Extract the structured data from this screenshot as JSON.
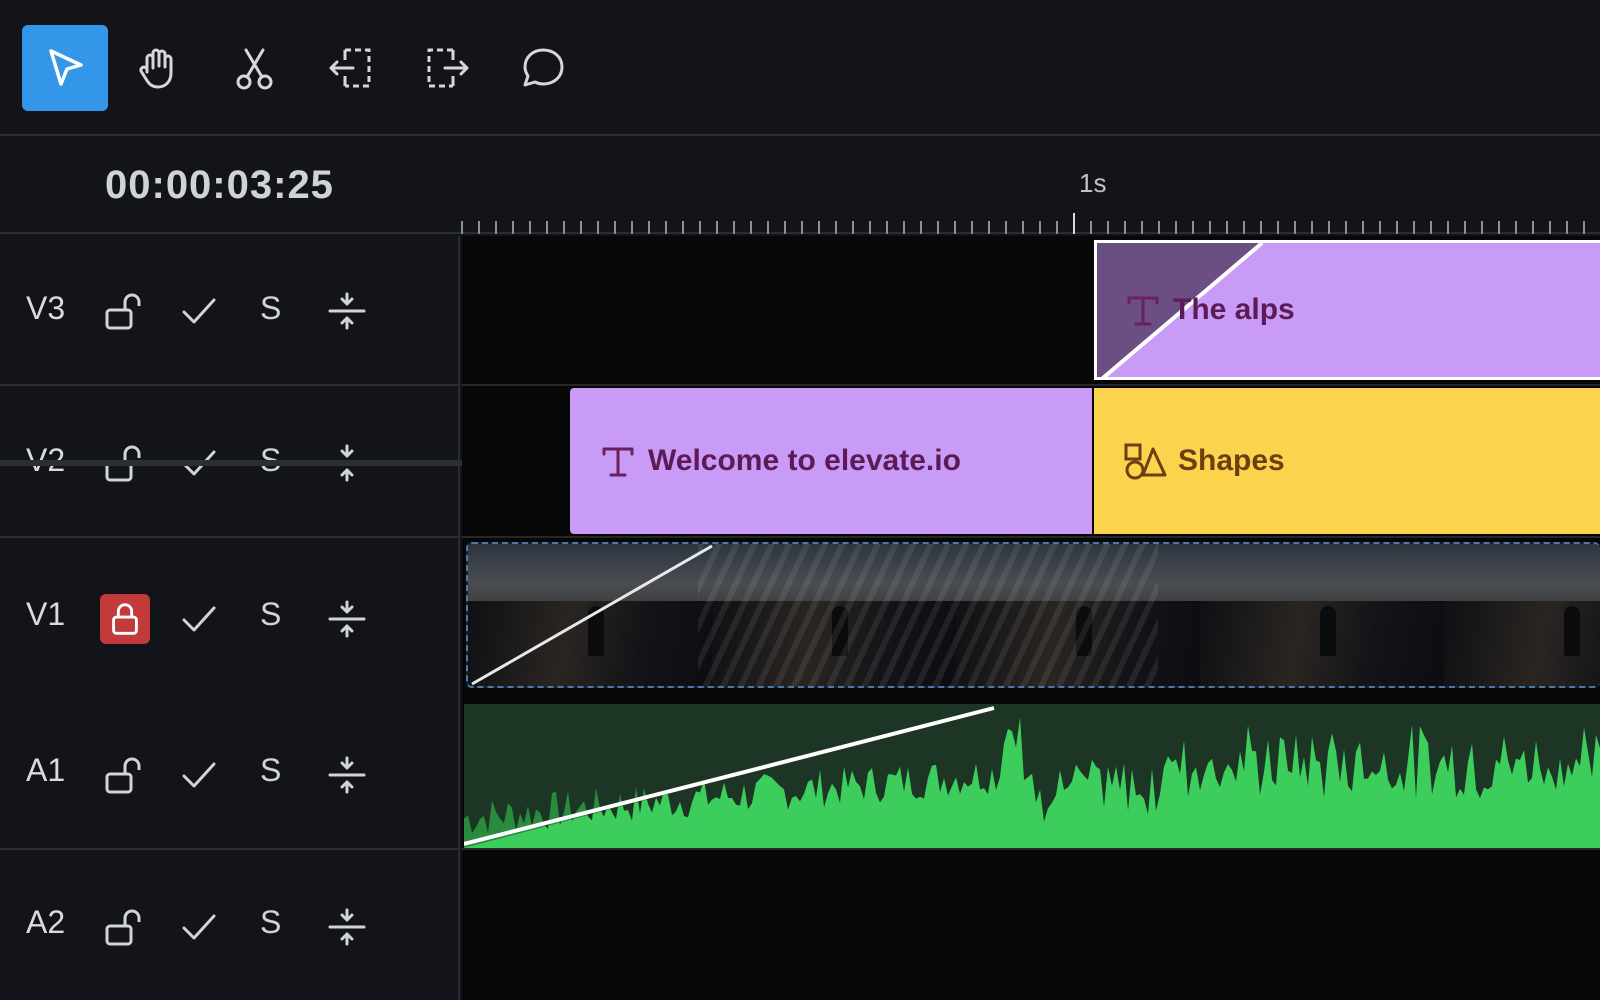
{
  "toolbar": {
    "tools": [
      {
        "name": "select",
        "icon": "pointer-icon",
        "active": true
      },
      {
        "name": "hand",
        "icon": "hand-icon",
        "active": false
      },
      {
        "name": "cut",
        "icon": "scissors-icon",
        "active": false
      },
      {
        "name": "trim-start",
        "icon": "trim-left-icon",
        "active": false
      },
      {
        "name": "trim-end",
        "icon": "trim-right-icon",
        "active": false
      },
      {
        "name": "comment",
        "icon": "comment-icon",
        "active": false
      }
    ]
  },
  "ruler": {
    "timecode": "00:00:03:25",
    "marker_label": "1s"
  },
  "tracks": [
    {
      "name": "V3",
      "locked": false,
      "enabled": true,
      "solo_label": "S"
    },
    {
      "name": "V2",
      "locked": false,
      "enabled": true,
      "solo_label": "S"
    },
    {
      "name": "V1",
      "locked": true,
      "enabled": true,
      "solo_label": "S"
    },
    {
      "name": "A1",
      "locked": false,
      "enabled": true,
      "solo_label": "S"
    },
    {
      "name": "A2",
      "locked": false,
      "enabled": true,
      "solo_label": "S"
    }
  ],
  "clips": {
    "v3_text": {
      "label": "The alps",
      "icon": "text-icon"
    },
    "v2_text": {
      "label": "Welcome to elevate.io",
      "icon": "text-icon"
    },
    "v2_shapes": {
      "label": "Shapes",
      "icon": "shapes-icon"
    },
    "v1_video": {
      "icon": "video-thumbnail"
    },
    "a1_audio": {
      "icon": "waveform"
    }
  },
  "colors": {
    "accent": "#3396e8",
    "text_clip": "#c89bf7",
    "shape_clip": "#fbd34d",
    "audio_wave": "#3dcd5c",
    "lock_active": "#c23a3a"
  }
}
